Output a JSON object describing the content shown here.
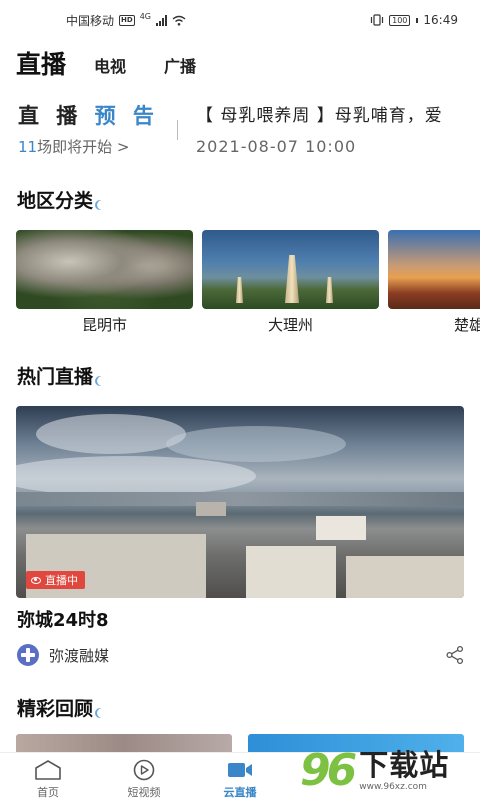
{
  "status_bar": {
    "carrier": "中国移动",
    "hd_badge": "HD",
    "network": "4G",
    "battery": "100",
    "time": "16:49"
  },
  "top_tabs": [
    {
      "label": "直播",
      "active": true
    },
    {
      "label": "电视",
      "active": false
    },
    {
      "label": "广播",
      "active": false
    }
  ],
  "preview": {
    "title_part1": "直 播",
    "title_part2": "预 告",
    "count": "11",
    "count_suffix": "场即将开始 >",
    "event_title": "【 母乳喂养周 】母乳哺育，爱",
    "event_time": "2021-08-07 10:00"
  },
  "region_section": {
    "title": "地区分类",
    "items": [
      {
        "label": "昆明市"
      },
      {
        "label": "大理州"
      },
      {
        "label": "楚雄州"
      }
    ]
  },
  "hot_section": {
    "title": "热门直播",
    "badge": "直播中",
    "video_title": "弥城24时8",
    "source": "弥渡融媒"
  },
  "review_section": {
    "title": "精彩回顾"
  },
  "bottom_nav": [
    {
      "label": "首页",
      "icon": "home-icon",
      "active": false
    },
    {
      "label": "短视频",
      "icon": "play-icon",
      "active": false
    },
    {
      "label": "云直播",
      "icon": "video-camera-icon",
      "active": true
    },
    {
      "label": "",
      "icon": "",
      "active": false
    },
    {
      "label": "",
      "icon": "",
      "active": false
    }
  ],
  "watermark": {
    "number": "96",
    "text": "下载站",
    "url": "www.96xz.com"
  },
  "colors": {
    "accent": "#3a86c8",
    "live_badge": "#e0473e",
    "watermark_green": "#7cc142"
  }
}
